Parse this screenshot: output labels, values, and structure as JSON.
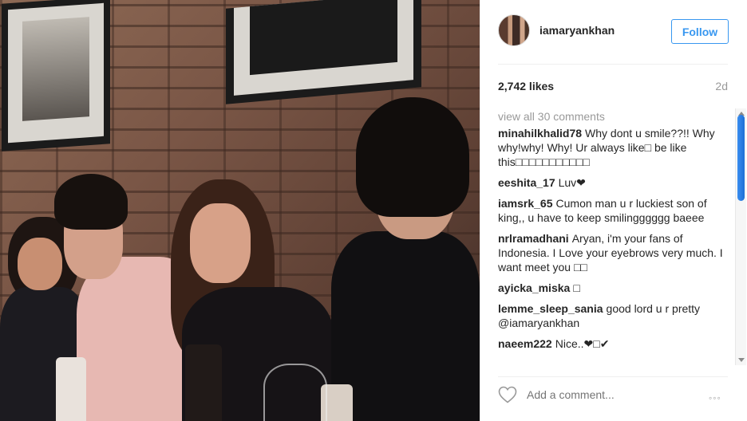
{
  "post": {
    "username": "iamaryankhan",
    "follow_label": "Follow",
    "likes": "2,742 likes",
    "age": "2d",
    "view_all_comments": "view all 30 comments",
    "comments": [
      {
        "user": "minahilkhalid78",
        "text": "Why dont u smile??!! Why why!why! Why! Ur always like□ be like this□□□□□□□□□□□"
      },
      {
        "user": "eeshita_17",
        "text": "Luv❤"
      },
      {
        "user": "iamsrk_65",
        "text": "Cumon man u r luckiest son of king,, u have to keep smilingggggg baeee"
      },
      {
        "user": "nrlramadhani",
        "text": "Aryan, i'm your fans of Indonesia. I Love your eyebrows very much. I want meet you □□"
      },
      {
        "user": "ayicka_miska",
        "text": "□"
      },
      {
        "user": "lemme_sleep_sania",
        "text": "good lord u r pretty @iamaryankhan"
      },
      {
        "user": "naeem222",
        "text": "Nice..❤□✔"
      }
    ],
    "add_comment_placeholder": "Add a comment...",
    "more_label": "◦◦◦"
  },
  "icons": {
    "heart": "heart-icon",
    "more": "more-options-icon",
    "avatar": "avatar"
  },
  "colors": {
    "accent": "#3897f0",
    "muted": "#999999",
    "text": "#262626"
  }
}
